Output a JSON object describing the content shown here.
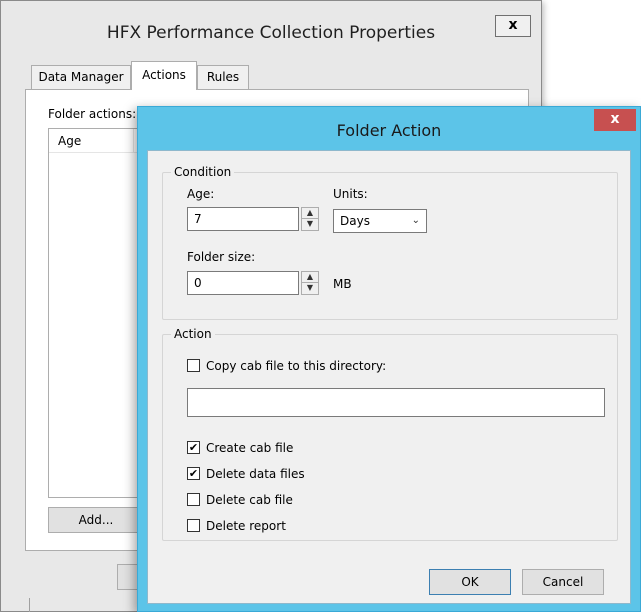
{
  "back_window": {
    "title": "HFX Performance Collection Properties",
    "close_label": "x",
    "tabs": [
      {
        "label": "Data Manager",
        "active": false
      },
      {
        "label": "Actions",
        "active": true
      },
      {
        "label": "Rules",
        "active": false
      }
    ],
    "folder_actions_label": "Folder actions:",
    "list_columns": [
      "Age"
    ],
    "add_button_label": "Add..."
  },
  "dialog": {
    "title": "Folder Action",
    "close_label": "x",
    "condition": {
      "group_label": "Condition",
      "age_label": "Age:",
      "age_value": "7",
      "units_label": "Units:",
      "units_value": "Days",
      "folder_size_label": "Folder size:",
      "folder_size_value": "0",
      "folder_size_unit": "MB"
    },
    "action": {
      "group_label": "Action",
      "copy_cab": {
        "label": "Copy cab file to this directory:",
        "checked": false
      },
      "directory_value": "",
      "checkboxes": [
        {
          "label": "Create cab file",
          "checked": true
        },
        {
          "label": "Delete data files",
          "checked": true
        },
        {
          "label": "Delete cab file",
          "checked": false
        },
        {
          "label": "Delete report",
          "checked": false
        }
      ]
    },
    "ok_label": "OK",
    "cancel_label": "Cancel"
  },
  "icons": {
    "spin_up": "up-arrow-icon",
    "spin_down": "down-arrow-icon",
    "dropdown": "chevron-down-icon",
    "check": "checkmark-icon"
  }
}
